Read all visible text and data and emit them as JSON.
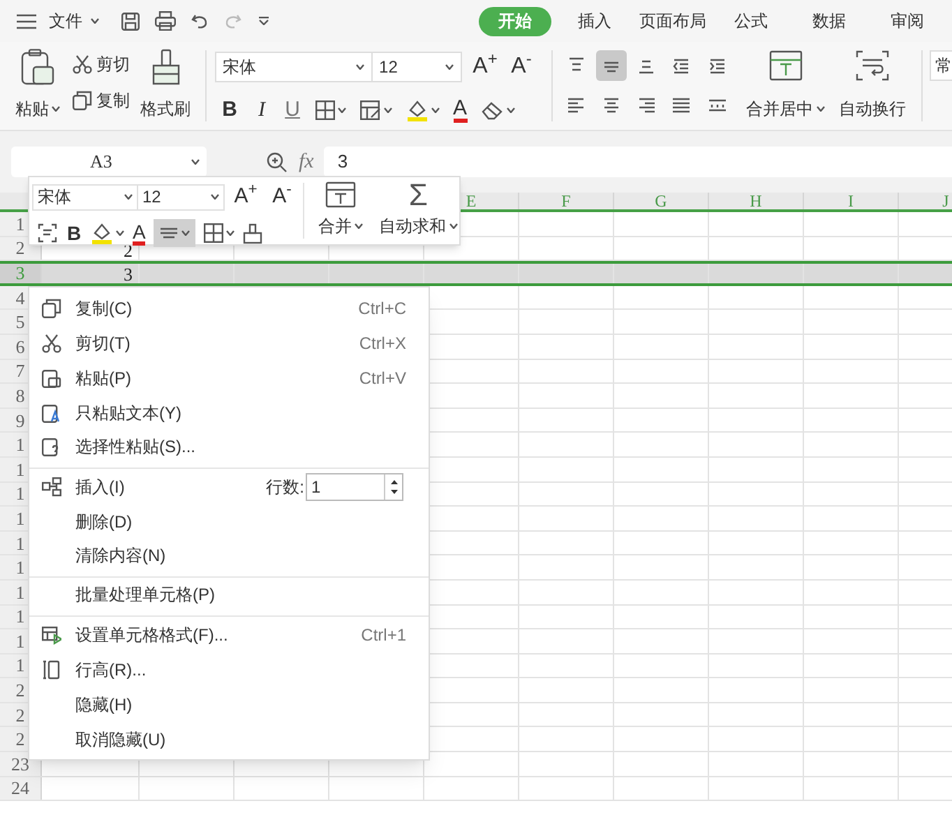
{
  "title_bar": {
    "file_menu": "文件",
    "tabs": [
      {
        "label": "开始",
        "selected": true
      },
      {
        "label": "插入",
        "selected": false
      },
      {
        "label": "页面布局",
        "selected": false
      },
      {
        "label": "公式",
        "selected": false
      },
      {
        "label": "数据",
        "selected": false
      },
      {
        "label": "审阅",
        "selected": false
      }
    ]
  },
  "ribbon": {
    "paste": "粘贴",
    "cut": "剪切",
    "copy": "复制",
    "format_painter": "格式刷",
    "font": "宋体",
    "font_size": "12",
    "grow": "A$^{+}$",
    "shrink": "A$^{-}$",
    "bold": "B",
    "italic": "I",
    "underline": "U",
    "font_color": "A",
    "alignment_buttons": [
      {
        "selected": false
      },
      {
        "selected": true
      },
      {
        "selected": false
      },
      {
        "selected": false
      },
      {
        "selected": false
      },
      {
        "selected": false
      },
      {
        "selected": false
      },
      {
        "selected": false
      },
      {
        "selected": false
      },
      {
        "selected": false
      }
    ],
    "merge": "合并居中",
    "wrap": "自动换行",
    "number_format": "常"
  },
  "formula_bar": {
    "name_box": "A3",
    "fx": "fx",
    "value": "3"
  },
  "mini_toolbar": {
    "font": "宋体",
    "font_size": "12",
    "grow": "A$^{+}$",
    "shrink": "A$^{-}$",
    "bold": "B",
    "font_color": "A",
    "align_selected": true,
    "merge": "合并",
    "autosum_symbol": "Σ",
    "autosum": "自动求和"
  },
  "sheet": {
    "columns": [
      {
        "label": "E"
      },
      {
        "label": "F"
      },
      {
        "label": "G"
      },
      {
        "label": "H"
      },
      {
        "label": "I"
      },
      {
        "label": "J"
      }
    ],
    "rows": [
      {
        "label": "1",
        "selected": false
      },
      {
        "label": "2",
        "selected": false,
        "value": "2"
      },
      {
        "label": "3",
        "selected": true,
        "value": "3"
      },
      {
        "label": "4",
        "selected": false
      },
      {
        "label": "5",
        "selected": false
      },
      {
        "label": "6",
        "selected": false
      },
      {
        "label": "7",
        "selected": false
      },
      {
        "label": "8",
        "selected": false
      },
      {
        "label": "9",
        "selected": false
      },
      {
        "label": "1",
        "selected": false
      },
      {
        "label": "1",
        "selected": false
      },
      {
        "label": "1",
        "selected": false
      },
      {
        "label": "1",
        "selected": false
      },
      {
        "label": "1",
        "selected": false
      },
      {
        "label": "1",
        "selected": false
      },
      {
        "label": "1",
        "selected": false
      },
      {
        "label": "1",
        "selected": false
      },
      {
        "label": "1",
        "selected": false
      },
      {
        "label": "1",
        "selected": false
      },
      {
        "label": "2",
        "selected": false
      },
      {
        "label": "2",
        "selected": false
      },
      {
        "label": "2",
        "selected": false
      },
      {
        "label": "23",
        "selected": false
      },
      {
        "label": "24",
        "selected": false
      }
    ]
  },
  "context_menu": [
    {
      "kind": "item",
      "label": "复制(C)",
      "shortcut": "Ctrl+C",
      "divider_after": false
    },
    {
      "kind": "item",
      "label": "剪切(T)",
      "shortcut": "Ctrl+X",
      "divider_after": false
    },
    {
      "kind": "item",
      "label": "粘贴(P)",
      "shortcut": "Ctrl+V",
      "divider_after": false
    },
    {
      "kind": "item",
      "label": "只粘贴文本(Y)",
      "divider_after": false
    },
    {
      "kind": "item",
      "label": "选择性粘贴(S)...",
      "divider_after": true
    },
    {
      "kind": "insert",
      "label": "插入(I)",
      "count_label": "行数:",
      "count": "1",
      "divider_after": false
    },
    {
      "kind": "item",
      "label": "删除(D)",
      "divider_after": false
    },
    {
      "kind": "item",
      "label": "清除内容(N)",
      "divider_after": true
    },
    {
      "kind": "item",
      "label": "批量处理单元格(P)",
      "divider_after": true
    },
    {
      "kind": "item",
      "label": "设置单元格格式(F)...",
      "shortcut": "Ctrl+1",
      "divider_after": false
    },
    {
      "kind": "item",
      "label": "行高(R)...",
      "divider_after": false
    },
    {
      "kind": "item",
      "label": "隐藏(H)",
      "divider_after": false
    },
    {
      "kind": "item",
      "label": "取消隐藏(U)",
      "divider_after": false
    }
  ]
}
